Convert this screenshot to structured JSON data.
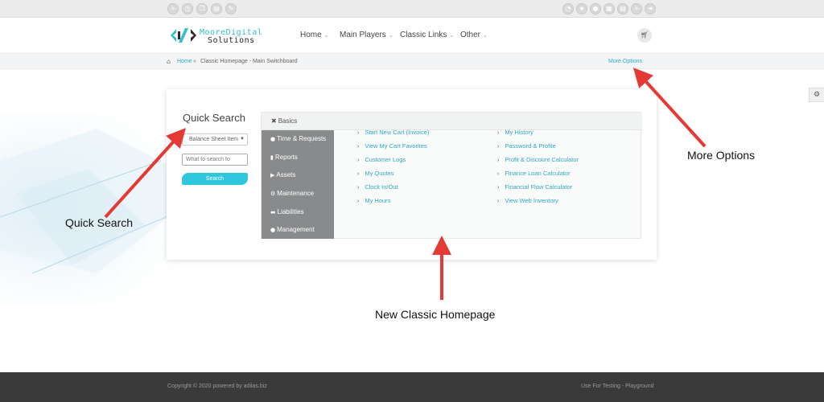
{
  "topbar": {
    "left_icons": [
      "plus-icon",
      "clock-icon",
      "copy-icon",
      "file-icon",
      "magic-icon"
    ],
    "right_icons": [
      "dashboard-icon",
      "star-icon",
      "users-icon",
      "calendar-icon",
      "list-icon",
      "add-user-icon",
      "sign-out-icon"
    ]
  },
  "brand": {
    "line1": "MooreDigital",
    "line2": "Solutions",
    "accent_color": "#2fbfcf"
  },
  "nav": {
    "items": [
      {
        "label": "Home"
      },
      {
        "label": "Main Players"
      },
      {
        "label": "Classic Links"
      },
      {
        "label": "Other"
      }
    ],
    "cart_icon": "cart-icon"
  },
  "breadcrumb": {
    "home": "Home",
    "separator": "»",
    "current": "Classic Homepage - Main Switchboard",
    "more_options": "More Options"
  },
  "quick_search": {
    "title": "Quick Search",
    "select_value": "Balance Sheet Item",
    "input_placeholder": "What to search fo",
    "button_label": "Search"
  },
  "panel": {
    "top_tab": "Basics",
    "side_tabs": [
      {
        "label": "Time & Requests",
        "icon": "stopwatch-icon"
      },
      {
        "label": "Reports",
        "icon": "file-icon"
      },
      {
        "label": "Assets",
        "icon": "video-icon"
      },
      {
        "label": "Maintenance",
        "icon": "gear-icon"
      },
      {
        "label": "Liabilities",
        "icon": "credit-card-icon"
      },
      {
        "label": "Management",
        "icon": "user-icon"
      }
    ],
    "links_col1": [
      "Start New Cart (Invoice)",
      "View My Cart Favorites",
      "Customer Logs",
      "My Quotes",
      "Clock In/Out",
      "My Hours"
    ],
    "links_col2": [
      "My History",
      "Password & Profile",
      "Profit & Discount Calculator",
      "Finance Loan Calculator",
      "Financial Flow Calculator",
      "View Web Inventory"
    ],
    "link_color": "#2fa8c7"
  },
  "annotations": {
    "quick_search": "Quick Search",
    "more_options": "More Options",
    "new_classic_homepage": "New Classic Homepage",
    "arrow_color": "#e53935"
  },
  "footer": {
    "left": "Copyright © 2020 powered by adilas.biz",
    "right": "Use For Testing - Playground"
  }
}
